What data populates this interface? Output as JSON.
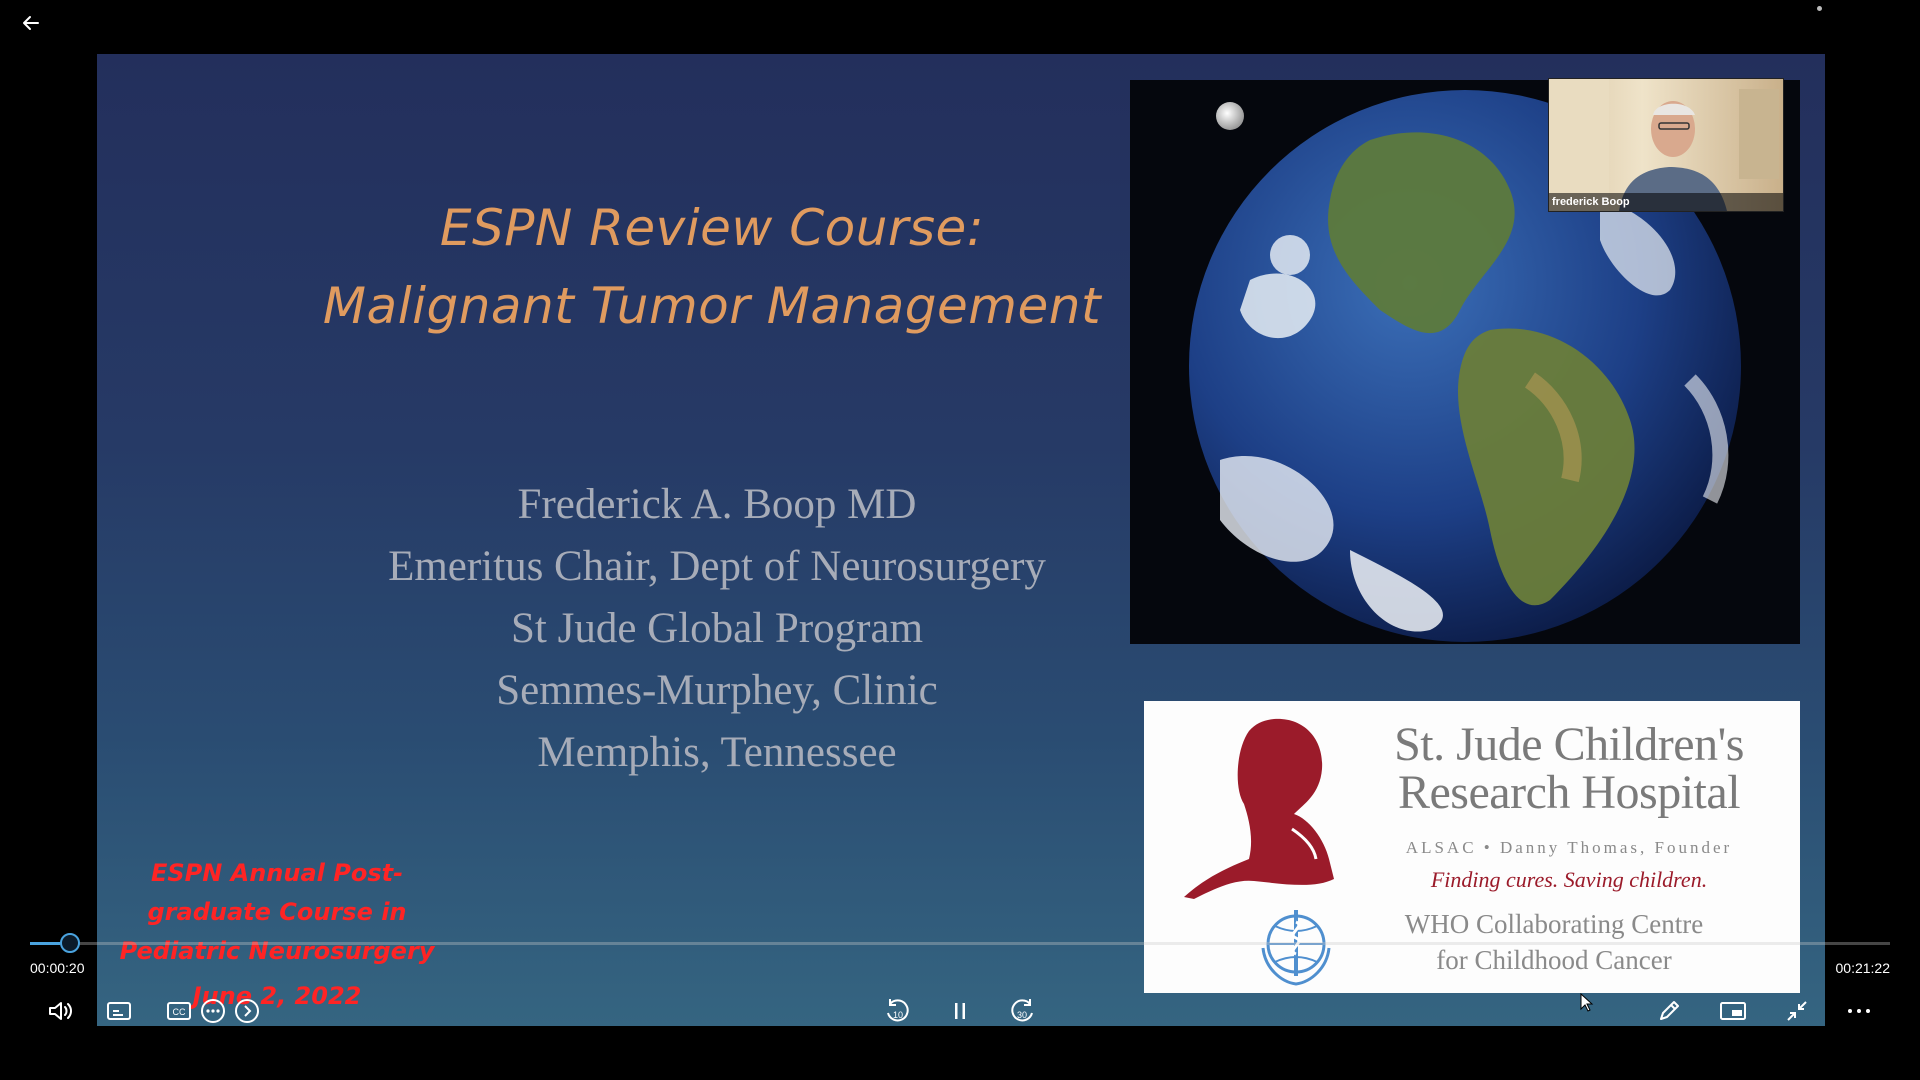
{
  "slide": {
    "title_lines": [
      "ESPN Review Course:",
      "Malignant Tumor Management"
    ],
    "presenter_lines": [
      "Frederick A. Boop MD",
      "Emeritus Chair, Dept of Neurosurgery",
      "St Jude Global Program",
      "Semmes-Murphey, Clinic",
      "Memphis, Tennessee"
    ],
    "course_note_lines": [
      "ESPN Annual Post-",
      "graduate Course in",
      "Pediatric Neurosurgery"
    ],
    "course_date": "June 2, 2022",
    "logo": {
      "name_lines": [
        "St. Jude Children's",
        "Research Hospital"
      ],
      "alsac": "ALSAC • Danny Thomas, Founder",
      "tagline": "Finding cures. Saving children.",
      "who_lines": [
        "WHO Collaborating Centre",
        "for Childhood Cancer"
      ]
    }
  },
  "webcam": {
    "name": "frederick Boop"
  },
  "player": {
    "current_time": "00:00:20",
    "total_time": "00:21:22",
    "progress": 0.016,
    "rewind_seconds": "10",
    "forward_seconds": "30",
    "accent_color": "#4aa3df",
    "icons": [
      "back-arrow-icon",
      "volume-icon",
      "captions-icon",
      "more-icon",
      "next-icon",
      "rewind-10-icon",
      "pause-icon",
      "forward-30-icon",
      "pen-icon",
      "mini-player-icon",
      "exit-fullscreen-icon",
      "more-horizontal-icon"
    ]
  }
}
